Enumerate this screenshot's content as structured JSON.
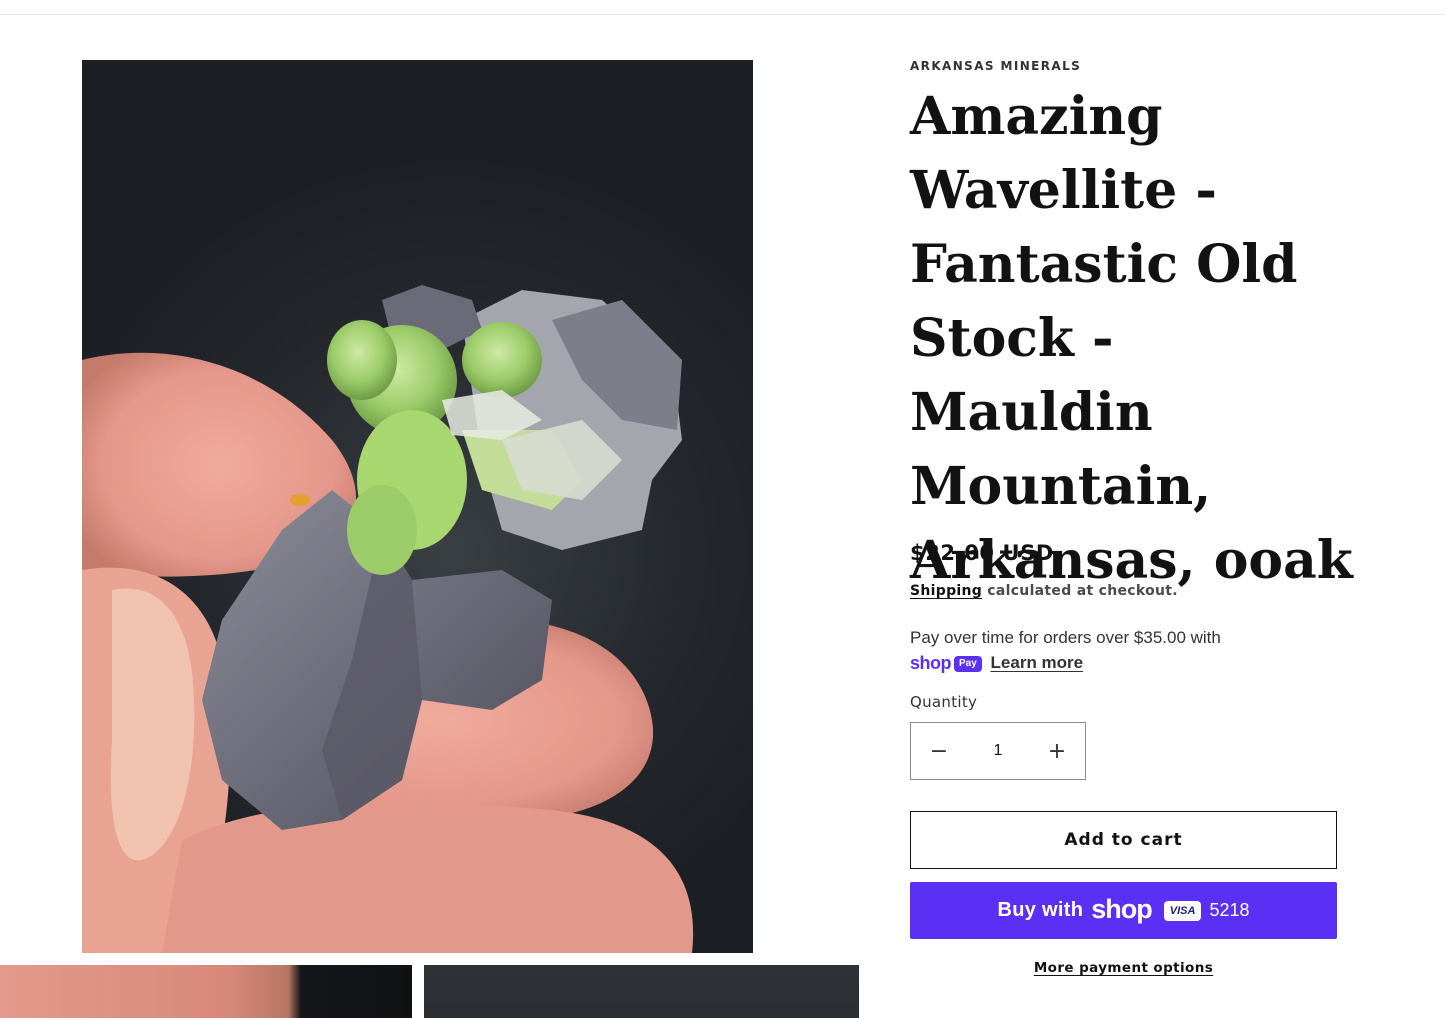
{
  "product": {
    "vendor": "ARKANSAS MINERALS",
    "title": "Amazing Wavellite - Fantastic Old Stock - Mauldin Mountain, Arkansas, ooak",
    "price": "$22.00 USD",
    "shipping_link": "Shipping",
    "shipping_rest": " calculated at checkout."
  },
  "installments": {
    "text": "Pay over time for orders over $35.00 with",
    "shop_word": "shop",
    "pay_pill": "Pay",
    "learn_more": "Learn more"
  },
  "quantity": {
    "label": "Quantity",
    "value": "1",
    "minus": "−",
    "plus": "+"
  },
  "buttons": {
    "add_to_cart": "Add to cart",
    "buy_with": "Buy with",
    "buy_shop": "shop",
    "card_brand": "VISA",
    "card_last4": "5218",
    "more_options": "More payment options"
  },
  "colors": {
    "shop_pay_purple": "#5a31f4",
    "text": "#121212"
  }
}
